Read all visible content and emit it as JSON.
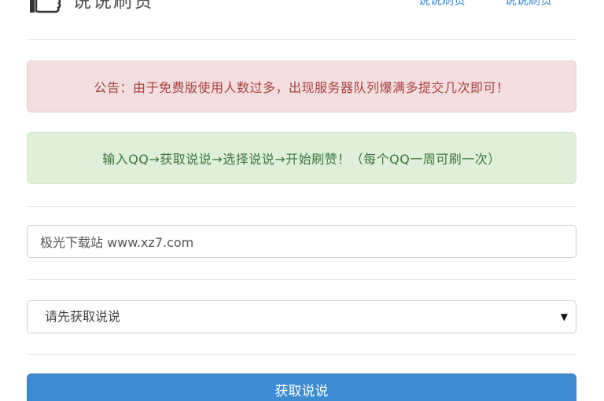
{
  "header": {
    "site_title": "说说刷赞",
    "nav": [
      "说说刷赞",
      "说说刷赞"
    ]
  },
  "notice": {
    "text": "公告：由于免费版使用人数过多，出现服务器队列爆满多提交几次即可！"
  },
  "instructions": {
    "text": "输入QQ→获取说说→选择说说→开始刷赞！（每个QQ一周可刷一次）"
  },
  "qq_input": {
    "value": "极光下载站 www.xz7.com"
  },
  "shuoshuo_select": {
    "selected": "请先获取说说"
  },
  "fetch_button": {
    "label": "获取说说"
  },
  "colors": {
    "danger_bg": "#f2dede",
    "danger_text": "#a94442",
    "success_bg": "#dff0d8",
    "success_text": "#3c763d",
    "primary": "#3d8bd1",
    "link": "#3a8fd6"
  }
}
